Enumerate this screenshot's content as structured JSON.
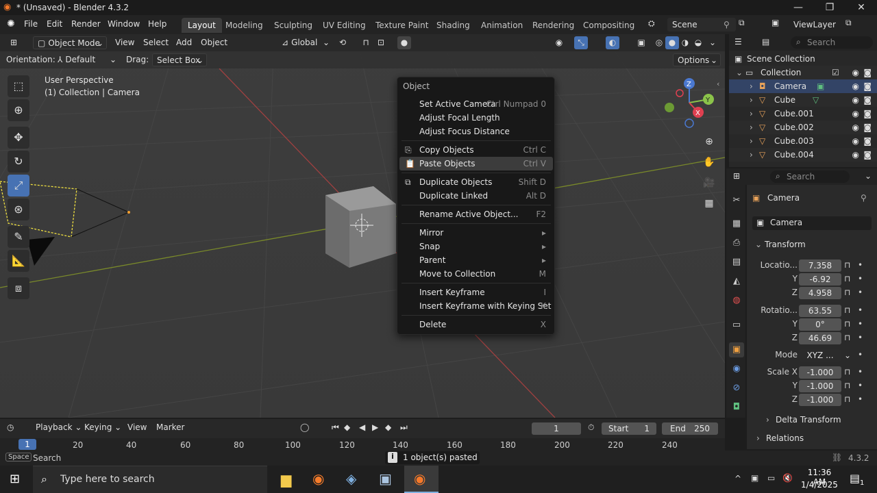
{
  "window": {
    "title": "* (Unsaved) - Blender 4.3.2"
  },
  "menubar": {
    "items": [
      "File",
      "Edit",
      "Render",
      "Window",
      "Help"
    ]
  },
  "workspaces": [
    "Layout",
    "Modeling",
    "Sculpting",
    "UV Editing",
    "Texture Paint",
    "Shading",
    "Animation",
    "Rendering",
    "Compositing"
  ],
  "scene": {
    "name": "Scene",
    "view_layer": "ViewLayer"
  },
  "viewport_header": {
    "mode": "Object Mode",
    "view": "View",
    "select": "Select",
    "add": "Add",
    "object": "Object",
    "transform_orientation": "Global"
  },
  "tool_settings": {
    "orientation_label": "Orientation:",
    "orientation_value": "Default",
    "drag_label": "Drag:",
    "drag_value": "Select Box",
    "options": "Options"
  },
  "viewport_info": {
    "line1": "User Perspective",
    "line2": "(1) Collection | Camera"
  },
  "gizmo": {
    "x": "X",
    "y": "Y",
    "z": "Z"
  },
  "context_menu": {
    "title": "Object",
    "items": [
      {
        "label": "Set Active Camera",
        "shortcut": "Ctrl Numpad 0"
      },
      {
        "label": "Adjust Focal Length",
        "shortcut": ""
      },
      {
        "label": "Adjust Focus Distance",
        "shortcut": ""
      },
      {
        "label": "Copy Objects",
        "shortcut": "Ctrl C"
      },
      {
        "label": "Paste Objects",
        "shortcut": "Ctrl V"
      },
      {
        "label": "Duplicate Objects",
        "shortcut": "Shift D"
      },
      {
        "label": "Duplicate Linked",
        "shortcut": "Alt D"
      },
      {
        "label": "Rename Active Object...",
        "shortcut": "F2"
      },
      {
        "label": "Mirror",
        "shortcut": "▸"
      },
      {
        "label": "Snap",
        "shortcut": "▸"
      },
      {
        "label": "Parent",
        "shortcut": "▸"
      },
      {
        "label": "Move to Collection",
        "shortcut": "M"
      },
      {
        "label": "Insert Keyframe",
        "shortcut": "I"
      },
      {
        "label": "Insert Keyframe with Keying Set",
        "shortcut": "K"
      },
      {
        "label": "Delete",
        "shortcut": "X"
      }
    ]
  },
  "outliner": {
    "search_placeholder": "Search",
    "root": "Scene Collection",
    "collection": "Collection",
    "objects": [
      "Camera",
      "Cube",
      "Cube.001",
      "Cube.002",
      "Cube.003",
      "Cube.004"
    ]
  },
  "properties": {
    "search_placeholder": "Search",
    "object_name": "Camera",
    "object_field": "Camera",
    "transform_header": "Transform",
    "location_label": "Locatio...",
    "location": [
      "7.358",
      "-6.92",
      "4.958"
    ],
    "rotation_label": "Rotatio...",
    "rotation": [
      "63.55",
      "0°",
      "46.69"
    ],
    "mode_label": "Mode",
    "mode_value": "XYZ ...",
    "scale_label": "Scale X",
    "scale": [
      "-1.000",
      "-1.000",
      "-1.000"
    ],
    "axis_y": "Y",
    "axis_z": "Z",
    "delta_transform": "Delta Transform",
    "relations": "Relations"
  },
  "timeline": {
    "playback": "Playback",
    "keying": "Keying",
    "view": "View",
    "marker": "Marker",
    "current_frame": "1",
    "start_label": "Start",
    "start_value": "1",
    "end_label": "End",
    "end_value": "250",
    "ruler_current": "1",
    "ruler_ticks": [
      "20",
      "40",
      "60",
      "80",
      "100",
      "120",
      "140",
      "160",
      "180",
      "200",
      "220",
      "240"
    ]
  },
  "statusbar": {
    "key": "Space",
    "action": "Search",
    "message": "1 object(s) pasted",
    "version": "4.3.2"
  },
  "taskbar": {
    "search_placeholder": "Type here to search",
    "time": "11:36 AM",
    "date": "1/4/2025",
    "notif_count": "1"
  }
}
